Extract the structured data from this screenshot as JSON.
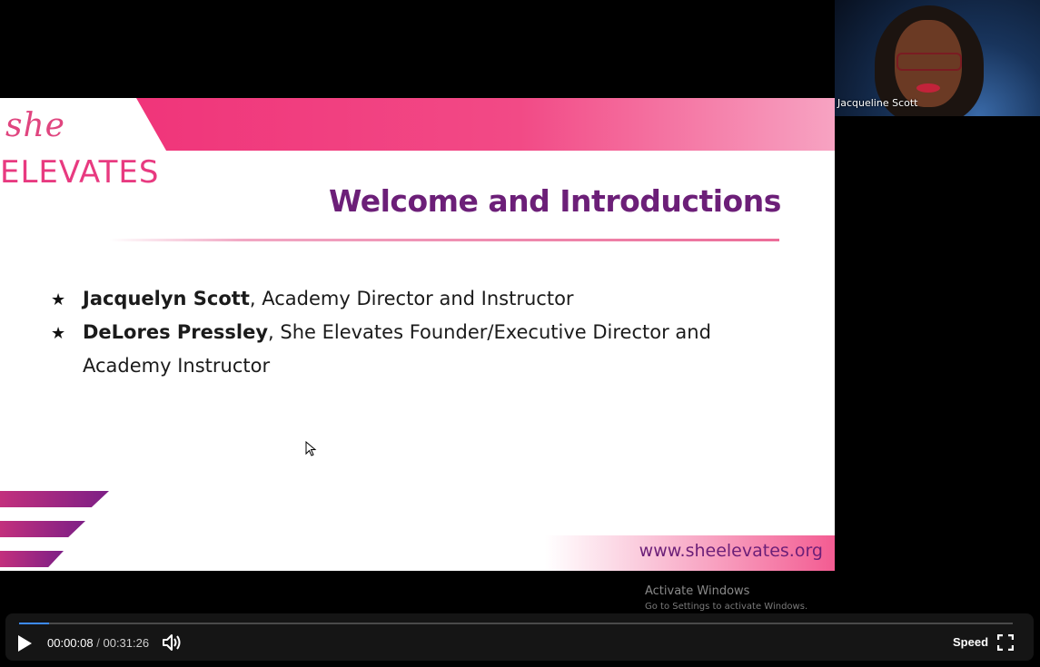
{
  "slide": {
    "logo_script": "she",
    "logo_word": "ELEVATES",
    "title": "Welcome and Introductions",
    "bullets": [
      {
        "name": "Jacquelyn Scott",
        "rest": ", Academy Director and Instructor"
      },
      {
        "name": "DeLores Pressley",
        "rest": ", She Elevates Founder/Executive Director and Academy Instructor"
      }
    ],
    "bullet_icon": "star-icon",
    "footer_url": "www.sheelevates.org",
    "colors": {
      "accent_pink": "#f0357a",
      "title_purple": "#6c1f78"
    }
  },
  "participant": {
    "name": "Jacqueline Scott"
  },
  "watermark": {
    "title": "Activate Windows",
    "subtitle": "Go to Settings to activate Windows."
  },
  "player": {
    "current_time": "00:00:08",
    "separator": "/",
    "total_time": "00:31:26",
    "progress_fraction": 0.0042,
    "speed_label": "Speed",
    "icons": {
      "play": "play-icon",
      "volume": "volume-icon",
      "fullscreen": "fullscreen-icon"
    }
  }
}
